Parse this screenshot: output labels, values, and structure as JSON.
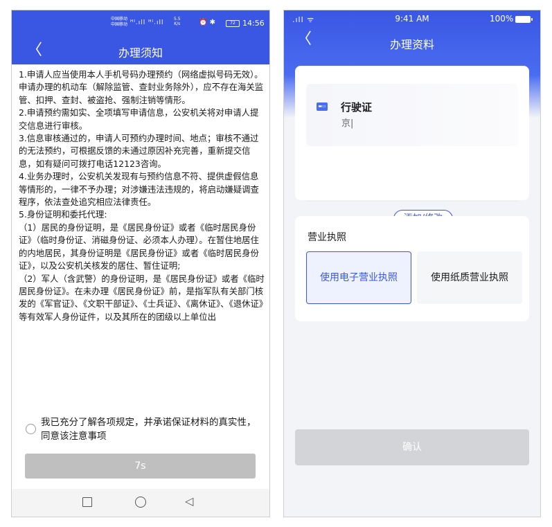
{
  "left_screen": {
    "status_bar": {
      "carrier_line1": "中国移动",
      "carrier_line2": "中国移动",
      "signal": "ᴴᴵ.ıll ᴴᴵ.ıll",
      "net_speed_value": "5.5",
      "net_speed_unit": "K/s",
      "icons": "⏰ ✱",
      "battery": "72",
      "time": "14:56"
    },
    "nav": {
      "back": "〈",
      "title": "办理须知"
    },
    "notice_paragraphs": [
      "1.申请人应当使用本人手机号码办理预约（网络虚拟号码无效）。申请办理的机动车（解除监管、查封业务除外），应不存在海关监管、扣押、查封、被盗抢、强制注销等情形。",
      "2.申请预约需如实、全项填写申请信息，公安机关将对申请人提交信息进行审核。",
      "3.信息审核通过的，申请人可预约办理时间、地点；审核不通过的无法预约，可根据反馈的未通过原因补充完善，重新提交信息，如有疑问可拨打电话12123咨询。",
      "4.业务办理时，公安机关发现有与预约信息不符、提供虚假信息等情形的，一律不予办理；对涉嫌违法违规的，将启动嫌疑调查程序，依法查处追究相应法律责任。",
      "5.身份证明和委托代理:",
      "（1）居民的身份证明，是《居民身份证》或者《临时居民身份证》（临时身份证、消磁身份证、必须本人办理）。在暂住地居住的内地居民，其身份证明是《居民身份证》或者《临时居民身份证》，以及公安机关核发的居住、暂住证明;",
      "（2）军人（含武警）的身份证明，是《居民身份证》或者《临时居民身份证》。在未办理《居民身份证》前，是指军队有关部门核发的《军官证》、《文职干部证》、《士兵证》、《离休证》、《退休证》等有效军人身份证件，以及其所在的团级以上单位出"
    ],
    "agreement_text": "我已充分了解各项规定，并承诺保证材料的真实性，同意该注意事项",
    "countdown_button": "7s"
  },
  "right_screen": {
    "status_bar": {
      "signal": ".ıll ᯤ",
      "time": "9:41 AM",
      "battery_pct": "100%"
    },
    "nav": {
      "back": "〈",
      "title": "办理资料"
    },
    "license_card": {
      "icon_text": "▬▭",
      "title": "行驶证",
      "value": "京|",
      "edit_button": "添加/修改"
    },
    "business_license": {
      "label": "营业执照",
      "option_electronic": "使用电子营业执照",
      "option_paper": "使用纸质营业执照"
    },
    "confirm_button": "确认"
  }
}
